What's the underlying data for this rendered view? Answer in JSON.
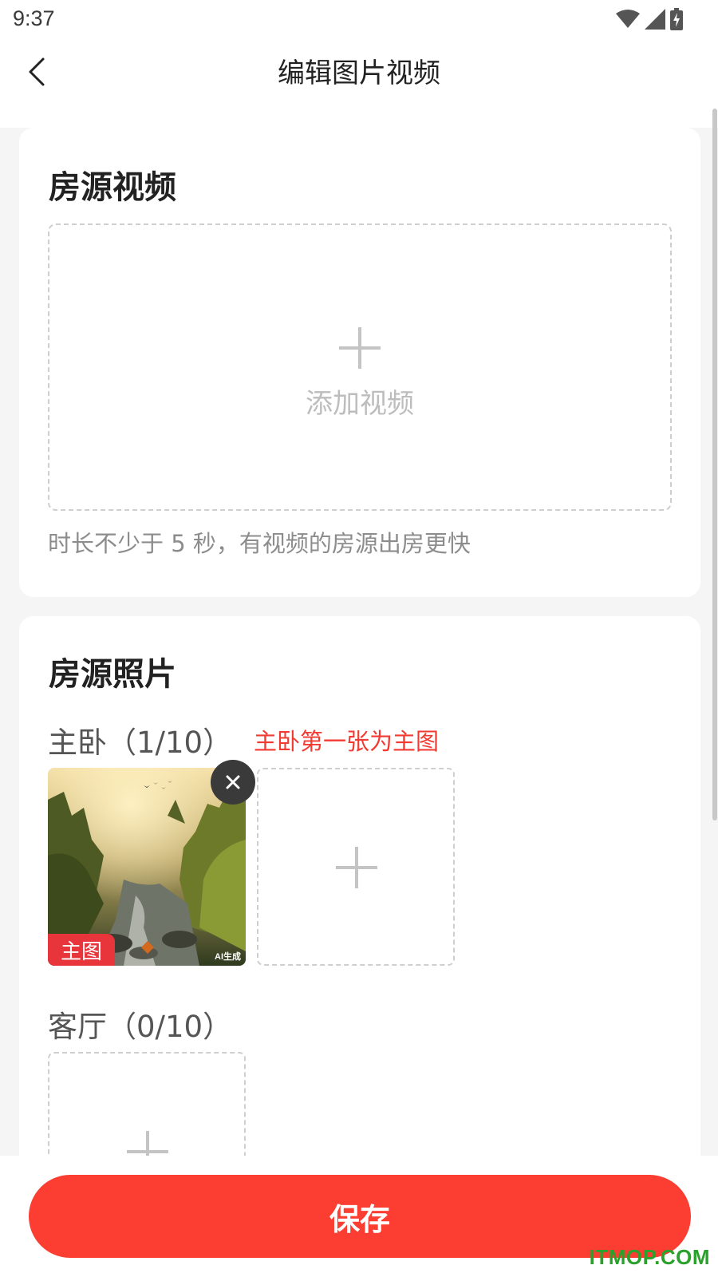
{
  "status_bar": {
    "time": "9:37",
    "icons": [
      "wifi-icon",
      "signal-icon",
      "battery-charging-icon"
    ]
  },
  "header": {
    "title": "编辑图片视频",
    "back_icon": "chevron-left-icon"
  },
  "video_section": {
    "title": "房源视频",
    "upload_label": "添加视频",
    "hint": "时长不少于 5 秒，有视频的房源出房更快"
  },
  "photo_section": {
    "title": "房源照片",
    "rooms": [
      {
        "label": "主卧（1/10）",
        "note": "主卧第一张为主图",
        "photos": [
          {
            "badge": "主图",
            "watermark": "AI生成"
          }
        ]
      },
      {
        "label": "客厅（0/10）",
        "photos": []
      }
    ]
  },
  "footer": {
    "save_label": "保存"
  },
  "site_watermark": "ITMOP.COM",
  "colors": {
    "accent": "#fc3d31",
    "badge": "#e8353b",
    "hint_red": "#f23a32",
    "background": "#f5f5f5",
    "card": "#ffffff"
  }
}
